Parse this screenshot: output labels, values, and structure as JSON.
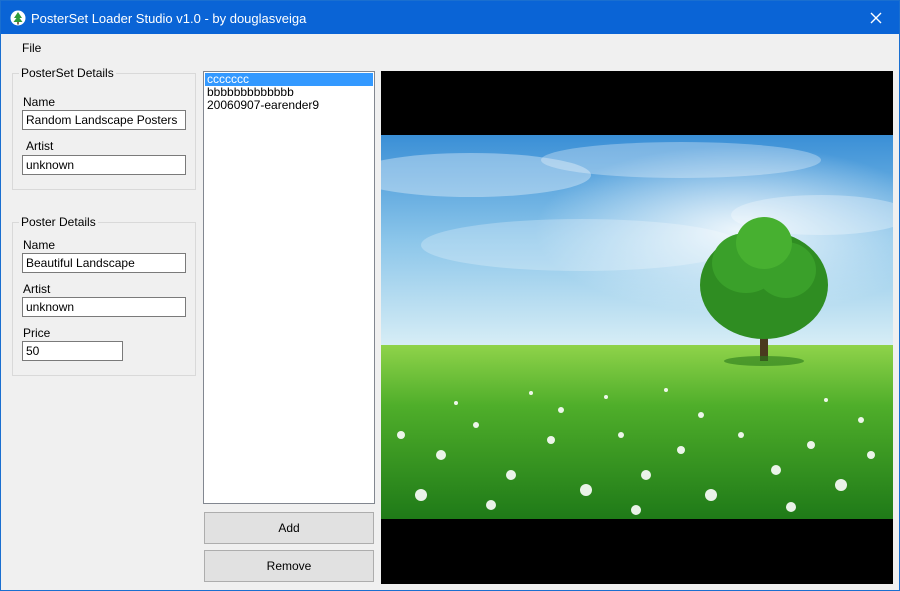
{
  "window": {
    "title": "PosterSet Loader Studio v1.0 - by douglasveiga"
  },
  "menu": {
    "file": "File"
  },
  "posterset": {
    "legend": "PosterSet Details",
    "name_label": "Name",
    "name_value": "Random Landscape Posters",
    "artist_label": "Artist",
    "artist_value": "unknown"
  },
  "poster": {
    "legend": "Poster Details",
    "name_label": "Name",
    "name_value": "Beautiful Landscape",
    "artist_label": "Artist",
    "artist_value": "unknown",
    "price_label": "Price",
    "price_value": "50"
  },
  "list": {
    "items": [
      {
        "label": "ccccccc",
        "selected": true
      },
      {
        "label": "bbbbbbbbbbbbb",
        "selected": false
      },
      {
        "label": "20060907-earender9",
        "selected": false
      }
    ]
  },
  "buttons": {
    "add": "Add",
    "remove": "Remove"
  },
  "colors": {
    "titlebar": "#0a64d6",
    "selection": "#3399ff",
    "window_bg": "#f0f0f0"
  },
  "icons": {
    "app": "tree-app-icon",
    "close": "close-icon"
  }
}
